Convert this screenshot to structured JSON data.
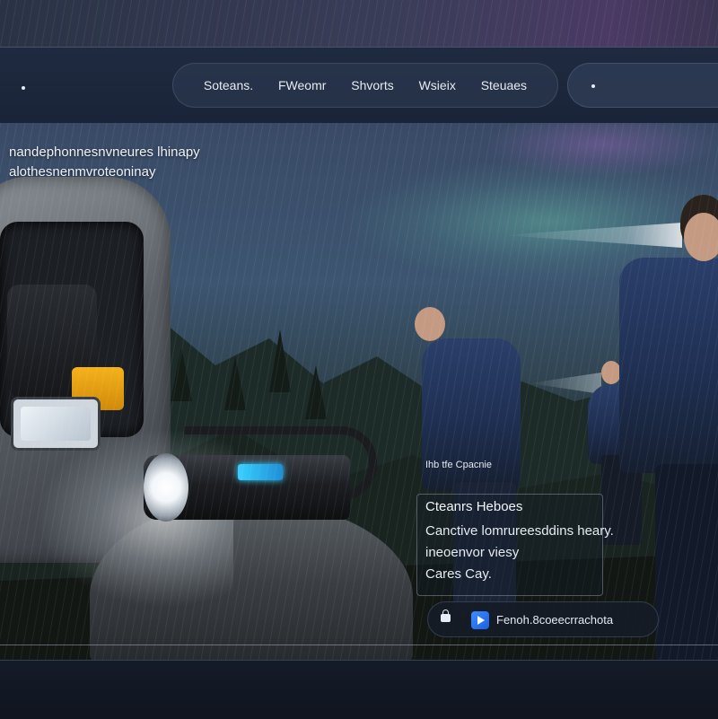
{
  "header": {
    "nav_items": [
      "Soteans.",
      "FWeomr",
      "Shvorts",
      "Wsieix",
      "Steuaes"
    ]
  },
  "hero": {
    "tagline_lines": [
      "nandephonnesnvneures lhinapy",
      "alothesnenmvroteoninay"
    ]
  },
  "card": {
    "kicker": "Ihb tfe Cpacnie",
    "title": "Cteanrs Heboes",
    "body_lines": [
      "Canctive lomrureesddins heary.",
      "ineoenvor viesy",
      "Cares Cay."
    ],
    "cta_label": "Fenoh.8coeecrrachota"
  },
  "colors": {
    "header_bg": "#1f2a40",
    "accent_blue": "#3a8cff",
    "flashlight_indicator": "#3ad0ff",
    "tool_yellow": "#f5b21b"
  },
  "icons": {
    "logo": "dot-logo-icon",
    "search": "search-dot-icon",
    "cta_lock": "lock-icon",
    "cta_play": "play-icon"
  }
}
